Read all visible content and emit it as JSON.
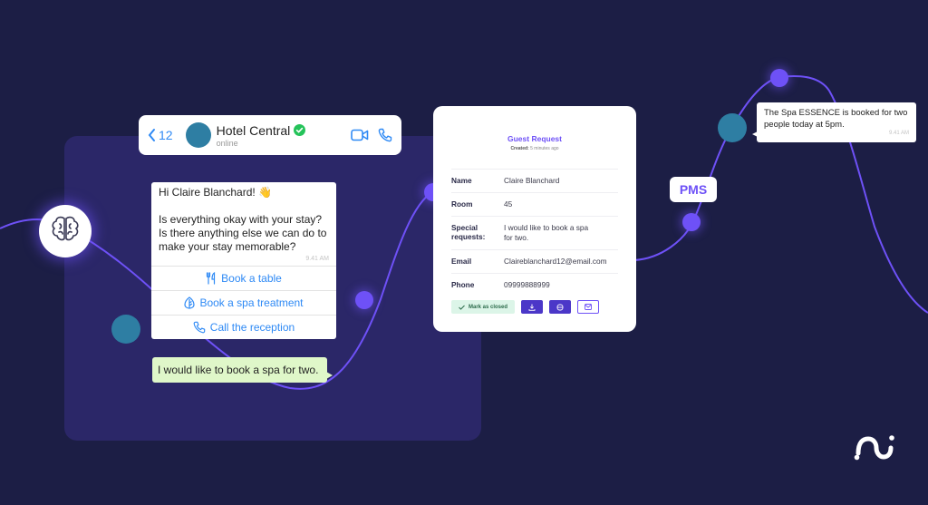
{
  "colors": {
    "background": "#1c1e45",
    "panel": "#2b2768",
    "accent": "#6e51f7",
    "teal": "#2e7ea3",
    "link_blue": "#2f8af5",
    "verified_green": "#25c35a",
    "reply_green": "#dff7c9"
  },
  "chat": {
    "header": {
      "back_count": "12",
      "title": "Hotel Central",
      "status": "online",
      "verified_icon": "check-badge-icon",
      "video_icon": "video-camera-icon",
      "phone_icon": "phone-icon"
    },
    "message": {
      "greeting": "Hi Claire Blanchard! 👋",
      "body": "Is everything okay with your stay? Is there anything else we can do to make your stay memorable?",
      "time": "9.41 AM"
    },
    "quick_replies": [
      {
        "label": "Book a table",
        "icon": "fork-knife-icon"
      },
      {
        "label": "Book a spa treatment",
        "icon": "leaf-icon"
      },
      {
        "label": "Call the reception",
        "icon": "phone-icon"
      }
    ],
    "user_reply": "I would like to book a spa for two."
  },
  "guest_request": {
    "title": "Guest Request",
    "created_label": "Created:",
    "created_value": "5 minutes ago",
    "fields": [
      {
        "key": "Name",
        "value": "Claire Blanchard"
      },
      {
        "key": "Room",
        "value": "45"
      },
      {
        "key": "Special requests:",
        "value": "I would like to book a spa for two."
      },
      {
        "key": "Email",
        "value": "Claireblanchard12@email.com"
      },
      {
        "key": "Phone",
        "value": "09999888999"
      }
    ],
    "actions": {
      "mark_closed": "Mark as closed",
      "download_icon": "download-icon",
      "print_icon": "print-icon",
      "email_icon": "mail-icon"
    }
  },
  "pms_label": "PMS",
  "spa_confirmation": {
    "text": "The Spa ESSENCE is booked for two people today at 5pm.",
    "time": "9.41 AM"
  },
  "brain_icon": "brain-icon",
  "logo_icon": "brand-logo-icon"
}
